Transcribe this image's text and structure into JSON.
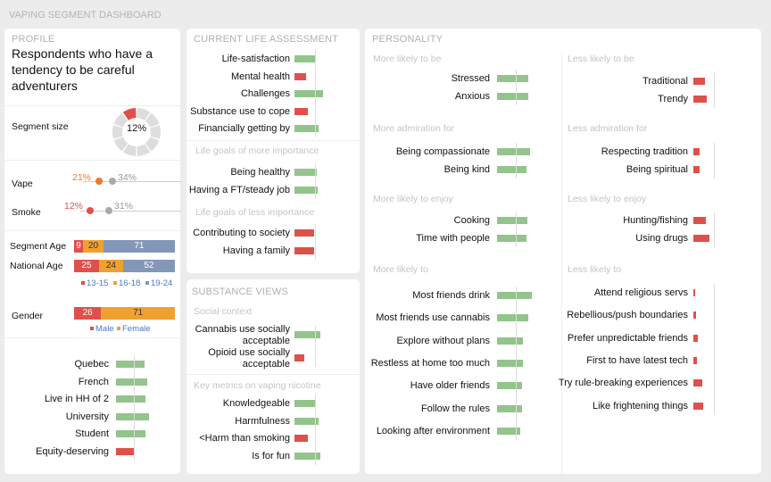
{
  "title": "VAPING SEGMENT DASHBOARD",
  "colors": {
    "positive": "#93c48b",
    "negative": "#e0504a",
    "orange": "#f0a030",
    "blue": "#8397b8",
    "gray": "#c8c8c8",
    "vape": "#ef7a2c"
  },
  "profile": {
    "heading": "PROFILE",
    "segment_name": "Respondents who have a tendency to be careful adventurers",
    "segment_size_label": "Segment size",
    "segment_size": "12%",
    "segment_size_value": 12,
    "vape": {
      "label": "Vape",
      "segment": "21%",
      "national": "34%"
    },
    "smoke": {
      "label": "Smoke",
      "segment": "12%",
      "national": "31%"
    },
    "age": {
      "segment_label": "Segment Age",
      "national_label": "National Age",
      "segment": [
        9,
        20,
        71
      ],
      "national": [
        25,
        24,
        52
      ],
      "legend": [
        "13-15",
        "16-18",
        "19-24"
      ]
    },
    "gender": {
      "label": "Gender",
      "values": [
        26,
        71
      ],
      "legend": [
        "Male",
        "Female"
      ]
    },
    "traits": [
      {
        "label": "Quebec",
        "value": 32,
        "dir": "pos"
      },
      {
        "label": "French",
        "value": 35,
        "dir": "pos"
      },
      {
        "label": "Live in HH of 2",
        "value": 33,
        "dir": "pos"
      },
      {
        "label": "University",
        "value": 37,
        "dir": "pos"
      },
      {
        "label": "Student",
        "value": 33,
        "dir": "pos"
      },
      {
        "label": "Equity-deserving",
        "value": 20,
        "dir": "neg"
      }
    ]
  },
  "life": {
    "heading": "CURRENT LIFE ASSESSMENT",
    "items": [
      {
        "label": "Life-satisfaction",
        "value": 24,
        "dir": "pos"
      },
      {
        "label": "Mental health",
        "value": 13,
        "dir": "neg"
      },
      {
        "label": "Challenges",
        "value": 32,
        "dir": "pos"
      },
      {
        "label": "Substance use to cope",
        "value": 15,
        "dir": "neg"
      },
      {
        "label": "Financially getting by",
        "value": 27,
        "dir": "pos"
      }
    ],
    "more_label": "Life goals of more importance",
    "more": [
      {
        "label": "Being healthy",
        "value": 25,
        "dir": "pos"
      },
      {
        "label": "Having a FT/steady job",
        "value": 26,
        "dir": "pos"
      }
    ],
    "less_label": "Life goals of less importance",
    "less": [
      {
        "label": "Contributing to society",
        "value": 22,
        "dir": "neg"
      },
      {
        "label": "Having a family",
        "value": 22,
        "dir": "neg"
      }
    ]
  },
  "substance": {
    "heading": "SUBSTANCE VIEWS",
    "social_label": "Social context",
    "social": [
      {
        "label": "Cannabis use socially acceptable",
        "value": 29,
        "dir": "pos"
      },
      {
        "label": "Opioid use socially acceptable",
        "value": 11,
        "dir": "neg"
      }
    ],
    "metrics_label": "Key metrics on vaping nicotine",
    "metrics": [
      {
        "label": "Knowledgeable",
        "value": 23,
        "dir": "pos"
      },
      {
        "label": "Harmfulness",
        "value": 27,
        "dir": "pos"
      },
      {
        "label": "<Harm than smoking",
        "value": 15,
        "dir": "neg"
      },
      {
        "label": "Is for fun",
        "value": 29,
        "dir": "pos"
      }
    ]
  },
  "personality": {
    "heading": "PERSONALITY",
    "left": [
      {
        "title": "More likely to be",
        "items": [
          {
            "label": "Stressed",
            "value": 35
          },
          {
            "label": "Anxious",
            "value": 35
          }
        ]
      },
      {
        "title": "More admiration for",
        "items": [
          {
            "label": "Being compassionate",
            "value": 37
          },
          {
            "label": "Being kind",
            "value": 33
          }
        ]
      },
      {
        "title": "More likely to enjoy",
        "items": [
          {
            "label": "Cooking",
            "value": 34
          },
          {
            "label": "Time  with people",
            "value": 33
          }
        ]
      },
      {
        "title": "More likely to",
        "items": [
          {
            "label": "Most friends drink",
            "value": 39
          },
          {
            "label": "Most friends use cannabis",
            "value": 35
          },
          {
            "label": "Explore without plans",
            "value": 29
          },
          {
            "label": "Restless at home too much",
            "value": 29
          },
          {
            "label": "Have older friends",
            "value": 28
          },
          {
            "label": "Follow the rules",
            "value": 28
          },
          {
            "label": "Looking after environment",
            "value": 26
          }
        ]
      }
    ],
    "right": [
      {
        "title": "Less likely to be",
        "items": [
          {
            "label": "Traditional",
            "value": 13
          },
          {
            "label": "Trendy",
            "value": 15
          }
        ]
      },
      {
        "title": "Less admiration for",
        "items": [
          {
            "label": "Respecting tradition",
            "value": 7
          },
          {
            "label": "Being spiritual",
            "value": 7
          }
        ]
      },
      {
        "title": "Less likely to enjoy",
        "items": [
          {
            "label": "Hunting/fishing",
            "value": 14
          },
          {
            "label": "Using drugs",
            "value": 18
          }
        ]
      },
      {
        "title": "Less likely to",
        "items": [
          {
            "label": "Attend religious servs",
            "value": 2
          },
          {
            "label": "Rebellious/push boundaries",
            "value": 3
          },
          {
            "label": "Prefer unpredictable friends",
            "value": 5
          },
          {
            "label": "First to have latest tech",
            "value": 4
          },
          {
            "label": "Try rule-breaking experiences",
            "value": 10
          },
          {
            "label": "Like frightening things",
            "value": 11
          }
        ]
      }
    ]
  }
}
